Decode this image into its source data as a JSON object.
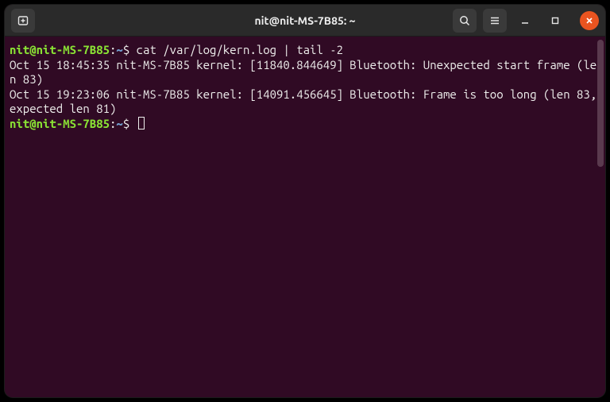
{
  "titlebar": {
    "title": "nit@nit-MS-7B85: ~"
  },
  "prompt": {
    "user_host": "nit@nit-MS-7B85",
    "sep": ":",
    "path": "~",
    "symbol": "$"
  },
  "session": {
    "command": "cat /var/log/kern.log | tail -2",
    "output": [
      "Oct 15 18:45:35 nit-MS-7B85 kernel: [11840.844649] Bluetooth: Unexpected start frame (len 83)",
      "Oct 15 19:23:06 nit-MS-7B85 kernel: [14091.456645] Bluetooth: Frame is too long (len 83, expected len 81)"
    ]
  },
  "icons": {
    "new_tab": "new-tab-icon",
    "search": "search-icon",
    "menu": "hamburger-icon",
    "minimize": "minimize-icon",
    "maximize": "maximize-icon",
    "close": "close-icon"
  },
  "colors": {
    "background": "#300a24",
    "foreground": "#eeeeec",
    "user": "#8ae234",
    "path": "#729fcf",
    "accent": "#e95420",
    "titlebar": "#2a2a2a"
  }
}
